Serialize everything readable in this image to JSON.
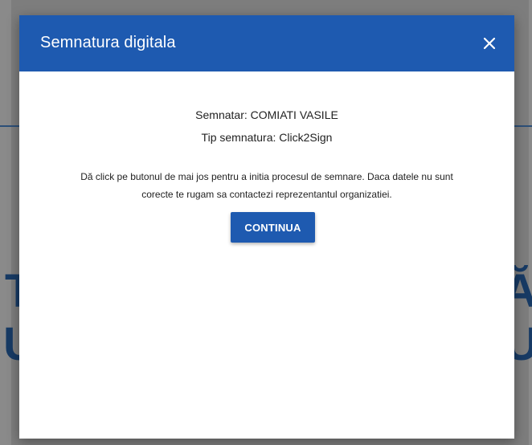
{
  "background": {
    "glyphs": {
      "left_upper": "T",
      "left_lower": "U",
      "right_upper": "Ă",
      "right_lower": "U"
    }
  },
  "dialog": {
    "title": "Semnatura digitala",
    "close_icon": "close-icon",
    "signer_text": "Semnatar: COMIATI VASILE",
    "signature_type_text": "Tip semnatura: Click2Sign",
    "description_line1": "Dă click pe butonul de mai jos pentru a initia procesul de semnare. Daca datele nu sunt",
    "description_line2": "corecte te rugam sa contactezi reprezentantul organizatiei.",
    "continue_label": "CONTINUA"
  },
  "colors": {
    "header": "#1e5ab0",
    "button": "#1e5ab0",
    "overlay": "#7d7d7d"
  }
}
